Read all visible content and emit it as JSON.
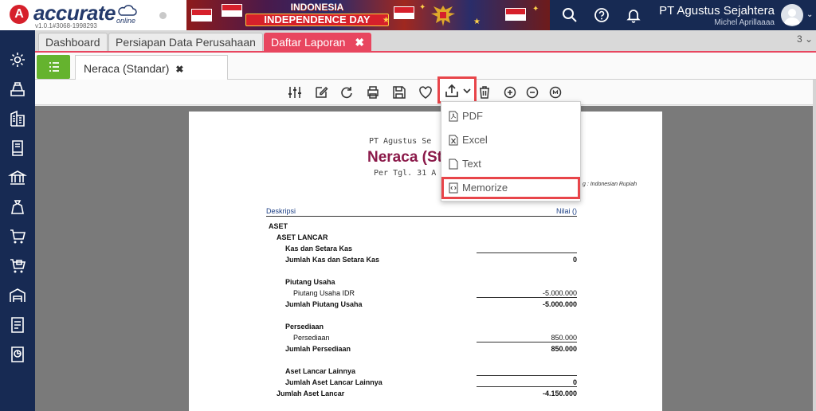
{
  "app": {
    "logo_letter": "A",
    "logo_text": "accurate",
    "logo_online": "online",
    "version": "v1.0.1#3068-1998293",
    "banner_line1": "INDONESIA",
    "banner_line2": "INDEPENDENCE DAY",
    "company_name": "PT Agustus Sejahtera",
    "user_name": "Michel Aprillaaaa"
  },
  "sidebar": {
    "items": [
      "gear-icon",
      "cash-register-icon",
      "building-icon",
      "book-icon",
      "bank-icon",
      "money-bag-icon",
      "cart-icon",
      "cart-box-icon",
      "warehouse-icon",
      "tax-icon",
      "report-icon"
    ]
  },
  "tabs": {
    "items": [
      {
        "label": "Dashboard"
      },
      {
        "label": "Persiapan Data Perusahaan"
      },
      {
        "label": "Daftar Laporan",
        "close": "✖"
      }
    ],
    "count": "3 ⌄"
  },
  "subtab": {
    "label": "Neraca (Standar)",
    "close": "✖"
  },
  "dropdown": {
    "items": [
      {
        "label": "PDF",
        "icon": "pdf-file-icon"
      },
      {
        "label": "Excel",
        "icon": "excel-file-icon"
      },
      {
        "label": "Text",
        "icon": "text-file-icon"
      },
      {
        "label": "Memorize",
        "icon": "memorize-icon"
      }
    ]
  },
  "report": {
    "company": "PT Agustus Se",
    "title": "Neraca (Sta",
    "date": "Per Tgl. 31 A",
    "currency": "g : Indonesian Rupiah",
    "col_desc": "Deskripsi",
    "col_value": "Nilai ()",
    "rows": [
      {
        "label": "ASET",
        "value": ""
      },
      {
        "label": "ASET LANCAR",
        "value": ""
      },
      {
        "label": "Kas dan Setara Kas",
        "value": ""
      },
      {
        "label": "Jumlah Kas dan Setara Kas",
        "value": "0"
      },
      {
        "label": "Piutang Usaha",
        "value": ""
      },
      {
        "label": "Piutang Usaha IDR",
        "value": "-5.000.000"
      },
      {
        "label": "Jumlah Piutang Usaha",
        "value": "-5.000.000"
      },
      {
        "label": "Persediaan",
        "value": ""
      },
      {
        "label": "Persediaan",
        "value": "850.000"
      },
      {
        "label": "Jumlah Persediaan",
        "value": "850.000"
      },
      {
        "label": "Aset Lancar Lainnya",
        "value": ""
      },
      {
        "label": "Jumlah Aset Lancar Lainnya",
        "value": "0"
      },
      {
        "label": "Jumlah Aset Lancar",
        "value": "-4.150.000"
      }
    ]
  },
  "colors": {
    "brand_navy": "#172a53",
    "accent_red": "#e8465f",
    "highlight_red": "#e8454a",
    "green": "#65b32e"
  }
}
